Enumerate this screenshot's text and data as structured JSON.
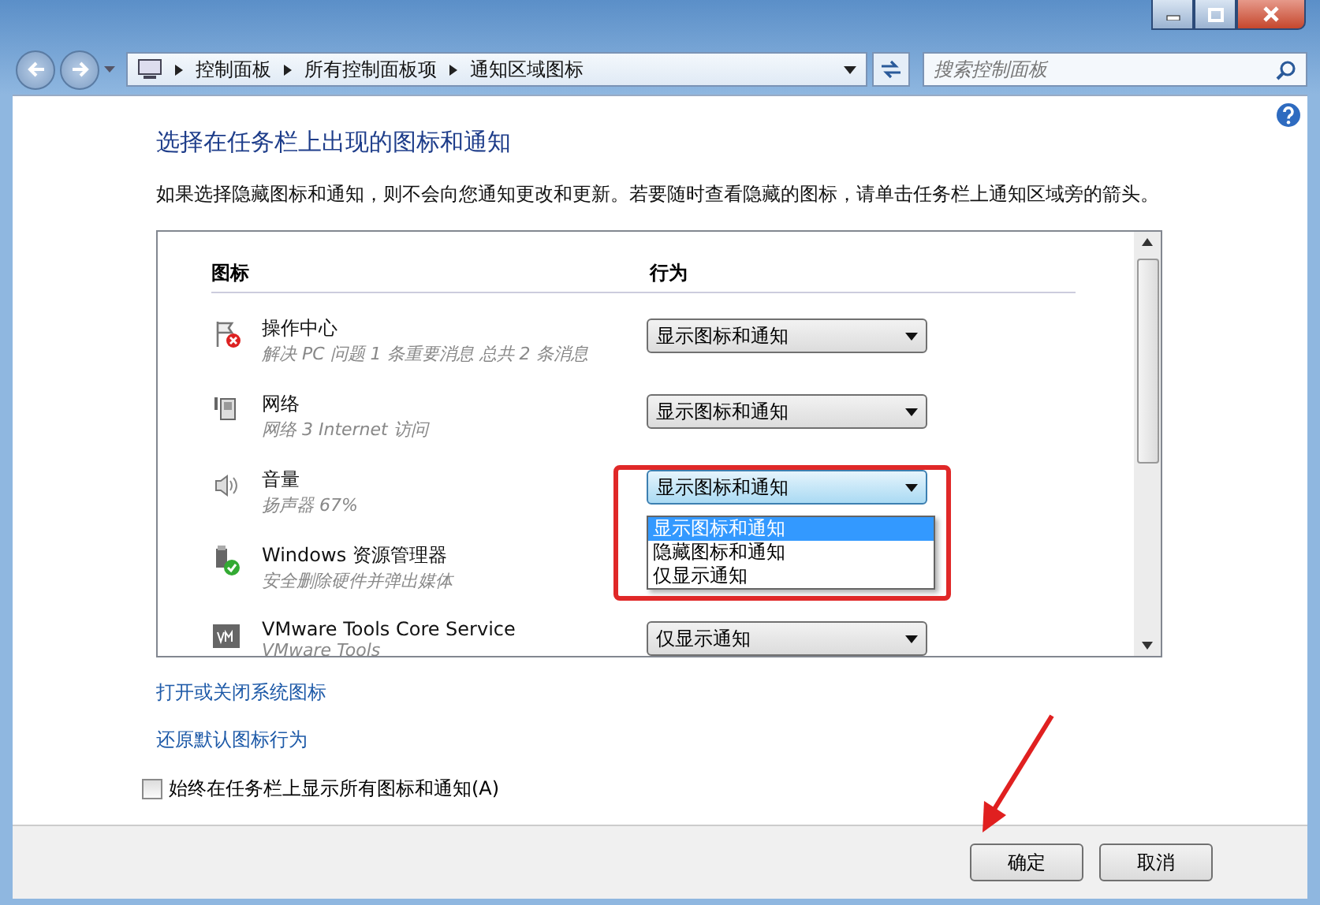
{
  "address_bar": {
    "breadcrumbs": [
      "控制面板",
      "所有控制面板项",
      "通知区域图标"
    ]
  },
  "search": {
    "placeholder": "搜索控制面板"
  },
  "heading": "选择在任务栏上出现的图标和通知",
  "description": "如果选择隐藏图标和通知，则不会向您通知更改和更新。若要随时查看隐藏的图标，请单击任务栏上通知区域旁的箭头。",
  "table": {
    "columns": [
      "图标",
      "行为"
    ],
    "rows": [
      {
        "kind": "flag",
        "name": "操作中心",
        "detail": "解决 PC 问题 1 条重要消息 总共 2 条消息",
        "behavior": "显示图标和通知"
      },
      {
        "kind": "network",
        "name": "网络",
        "detail": "网络 3 Internet 访问",
        "behavior": "显示图标和通知"
      },
      {
        "kind": "speaker",
        "name": "音量",
        "detail": "扬声器 67%",
        "behavior": "显示图标和通知",
        "options": [
          {
            "label": "显示图标和通知",
            "selected": true
          },
          {
            "label": "隐藏图标和通知",
            "selected": false
          },
          {
            "label": "仅显示通知",
            "selected": false
          }
        ]
      },
      {
        "kind": "usb",
        "name": "Windows 资源管理器",
        "detail": "安全删除硬件并弹出媒体"
      },
      {
        "kind": "vm",
        "name": "VMware Tools Core Service",
        "detail": "VMware Tools",
        "behavior": "仅显示通知"
      }
    ]
  },
  "links": [
    "打开或关闭系统图标",
    "还原默认图标行为"
  ],
  "checkbox": {
    "label": "始终在任务栏上显示所有图标和通知(A)",
    "checked": false
  },
  "buttons": [
    "确定",
    "取消"
  ]
}
